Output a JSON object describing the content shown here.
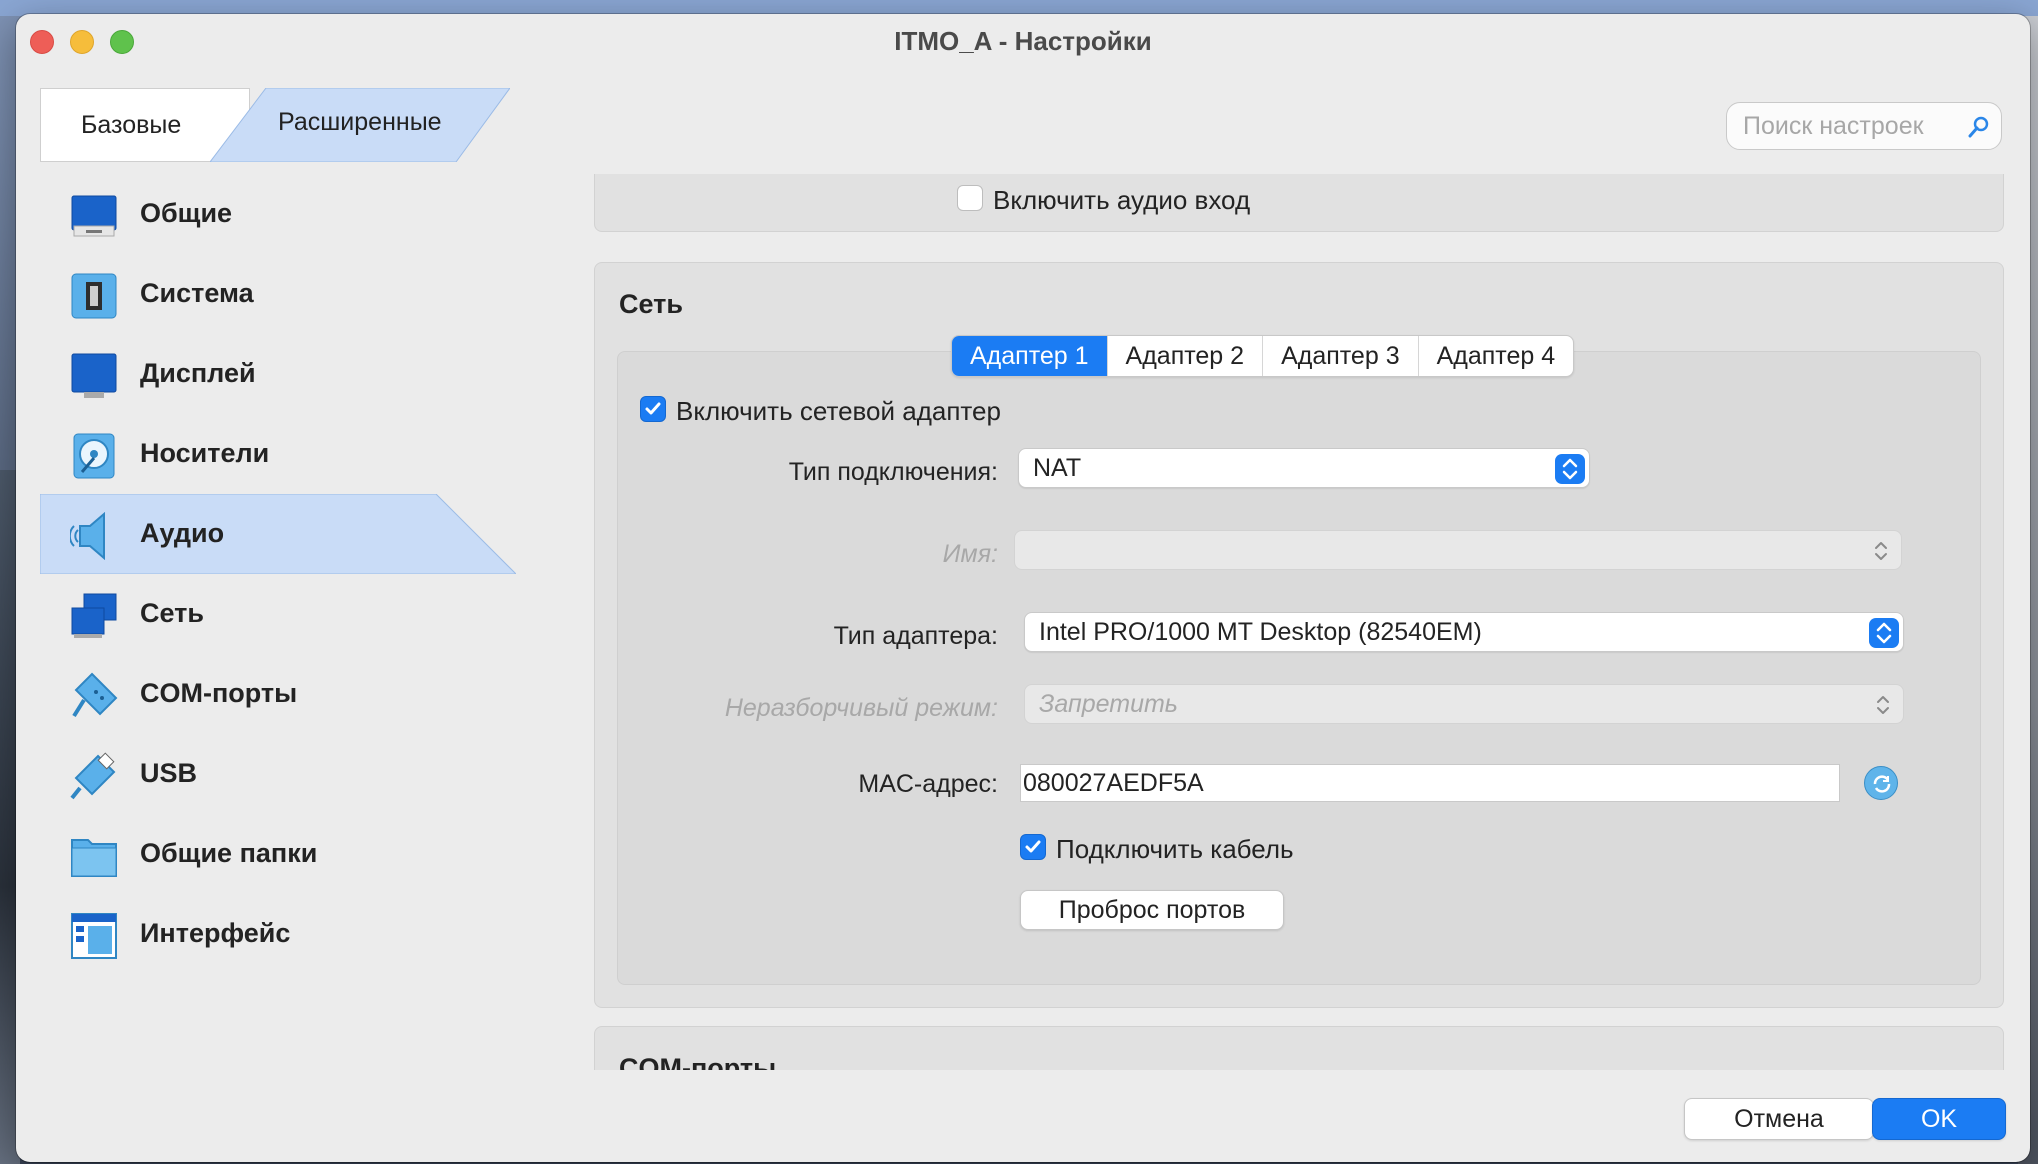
{
  "window": {
    "title": "ITMO_A - Настройки"
  },
  "mode_tabs": {
    "basic": "Базовые",
    "advanced": "Расширенные"
  },
  "search": {
    "placeholder": "Поиск настроек"
  },
  "sidebar": {
    "items": [
      {
        "label": "Общие",
        "icon": "general-icon"
      },
      {
        "label": "Система",
        "icon": "chip-icon"
      },
      {
        "label": "Дисплей",
        "icon": "monitor-icon"
      },
      {
        "label": "Носители",
        "icon": "disk-icon"
      },
      {
        "label": "Аудио",
        "icon": "speaker-icon",
        "active": true
      },
      {
        "label": "Сеть",
        "icon": "network-icon"
      },
      {
        "label": "COM-порты",
        "icon": "serial-port-icon"
      },
      {
        "label": "USB",
        "icon": "usb-icon"
      },
      {
        "label": "Общие папки",
        "icon": "folder-icon"
      },
      {
        "label": "Интерфейс",
        "icon": "interface-icon"
      }
    ]
  },
  "audio": {
    "enable_input_label": "Включить аудио вход",
    "enable_input_checked": false
  },
  "network": {
    "title": "Сеть",
    "tabs": [
      "Адаптер 1",
      "Адаптер 2",
      "Адаптер 3",
      "Адаптер 4"
    ],
    "active_tab": "Адаптер 1",
    "enable_adapter_label": "Включить сетевой адаптер",
    "enable_adapter_checked": true,
    "attachment_label": "Тип подключения:",
    "attachment_value": "NAT",
    "name_label": "Имя:",
    "name_value": "",
    "adapter_type_label": "Тип адаптера:",
    "adapter_type_value": "Intel PRO/1000 MT Desktop (82540EM)",
    "promisc_label": "Неразборчивый режим:",
    "promisc_value": "Запретить",
    "mac_label": "MAC-адрес:",
    "mac_value": "080027AEDF5A",
    "cable_label": "Подключить кабель",
    "cable_checked": true,
    "port_forwarding": "Проброс портов"
  },
  "next_section": {
    "title": "COM-порты"
  },
  "footer": {
    "cancel": "Отмена",
    "ok": "OK"
  },
  "colors": {
    "accent": "#1b7cf3",
    "sidebar_active": "#c9dcf7",
    "window_bg": "#ececec"
  }
}
